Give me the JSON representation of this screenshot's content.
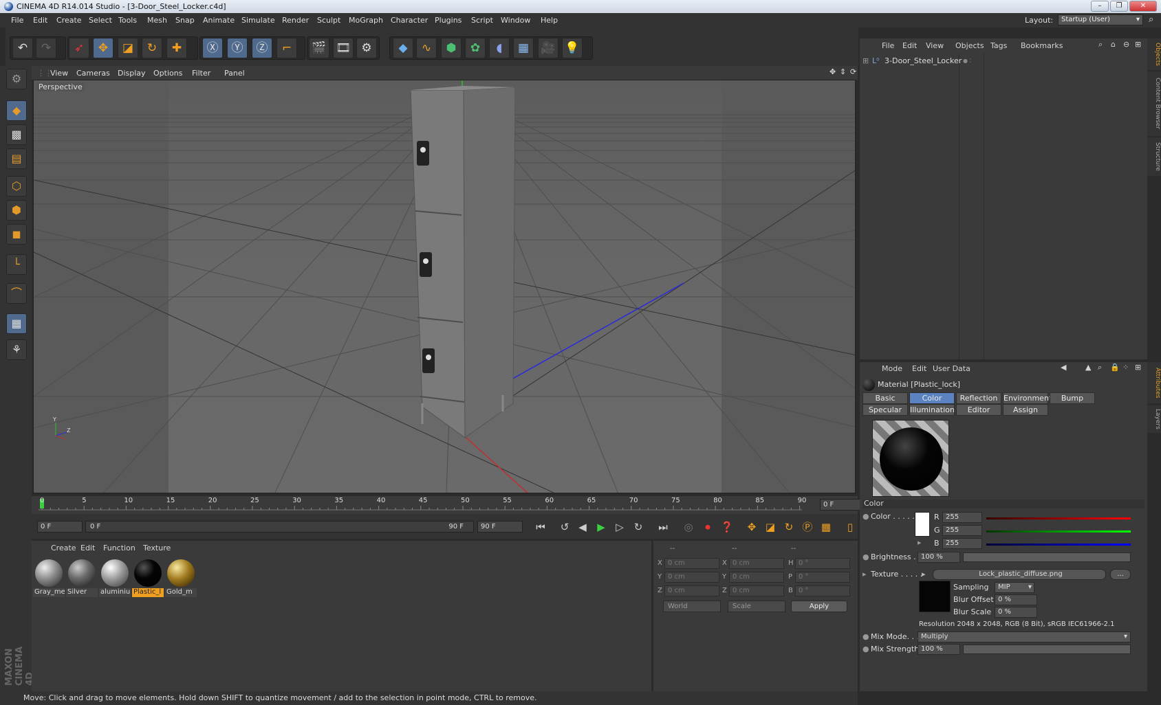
{
  "window": {
    "title": "CINEMA 4D R14.014 Studio - [3-Door_Steel_Locker.c4d]",
    "minimize": "–",
    "restore": "❐",
    "close": "✕"
  },
  "menubar": {
    "items": [
      "File",
      "Edit",
      "Create",
      "Select",
      "Tools",
      "Mesh",
      "Snap",
      "Animate",
      "Simulate",
      "Render",
      "Sculpt",
      "MoGraph",
      "Character",
      "Plugins",
      "Script",
      "Window",
      "Help"
    ],
    "layout_label": "Layout:",
    "layout_value": "Startup (User)"
  },
  "viewport": {
    "menu": [
      "View",
      "Cameras",
      "Display",
      "Options",
      "Filter",
      "Panel"
    ],
    "label": "Perspective",
    "axis_y": "Y",
    "axis_z": "Z"
  },
  "timeline": {
    "ticks": [
      "0",
      "5",
      "10",
      "15",
      "20",
      "25",
      "30",
      "35",
      "40",
      "45",
      "50",
      "55",
      "60",
      "65",
      "70",
      "75",
      "80",
      "85",
      "90"
    ],
    "current_frame": "0 F",
    "start_frame": "0 F",
    "range_start": "0 F",
    "range_end": "90 F",
    "end_frame": "90 F"
  },
  "materials": {
    "menu": [
      "Create",
      "Edit",
      "Function",
      "Texture"
    ],
    "items": [
      {
        "name": "Gray_me",
        "color": "#8a8a8a"
      },
      {
        "name": "Silver",
        "color": "#6d6d6d"
      },
      {
        "name": "aluminiu",
        "color": "#9a9a9a"
      },
      {
        "name": "Plastic_l",
        "color": "#050505"
      },
      {
        "name": "Gold_m",
        "color": "#a07a1e"
      }
    ],
    "selected": "Plastic_l"
  },
  "coords": {
    "headers": [
      "--",
      "--",
      "--"
    ],
    "rows": [
      {
        "a": "X",
        "av": "0 cm",
        "b": "X",
        "bv": "0 cm",
        "c": "H",
        "cv": "0 °"
      },
      {
        "a": "Y",
        "av": "0 cm",
        "b": "Y",
        "bv": "0 cm",
        "c": "P",
        "cv": "0 °"
      },
      {
        "a": "Z",
        "av": "0 cm",
        "b": "Z",
        "bv": "0 cm",
        "c": "B",
        "cv": "0 °"
      }
    ],
    "world": "World",
    "scale": "Scale",
    "apply": "Apply"
  },
  "status": "Move: Click and drag to move elements. Hold down SHIFT to quantize movement / add to the selection in point mode, CTRL to remove.",
  "maxon": "MAXON CINEMA 4D",
  "objects": {
    "menu": [
      "File",
      "Edit",
      "View",
      "Objects",
      "Tags",
      "Bookmarks"
    ],
    "tree": [
      "3-Door_Steel_Locker"
    ]
  },
  "attributes": {
    "menu": [
      "Mode",
      "Edit",
      "User Data"
    ],
    "title": "Material [Plastic_lock]",
    "tabs_row1": [
      "Basic",
      "Color",
      "Reflection",
      "Environment",
      "Bump"
    ],
    "tabs_row2": [
      "Specular",
      "Illumination",
      "Editor",
      "Assign"
    ],
    "active_tab": "Color",
    "section": "Color",
    "color_label": "Color . . . . .",
    "r_label": "R",
    "r": "255",
    "g_label": "G",
    "g": "255",
    "b_label": "B",
    "b": "255",
    "brightness_label": "Brightness . . .",
    "brightness": "100 %",
    "texture_label": "Texture . . . . .",
    "texture_file": "Lock_plastic_diffuse.png",
    "texture_more": "...",
    "sampling_label": "Sampling",
    "sampling": "MIP",
    "blur_offset_label": "Blur Offset",
    "blur_offset": "0 %",
    "blur_scale_label": "Blur Scale",
    "blur_scale": "0 %",
    "resolution": "Resolution 2048 x 2048, RGB (8 Bit), sRGB IEC61966-2.1",
    "mix_mode_label": "Mix Mode. . .",
    "mix_mode": "Multiply",
    "mix_strength_label": "Mix Strength",
    "mix_strength": "100 %"
  },
  "side_tabs": [
    "Objects",
    "Content Browser",
    "Structure",
    "Attributes",
    "Layers"
  ]
}
